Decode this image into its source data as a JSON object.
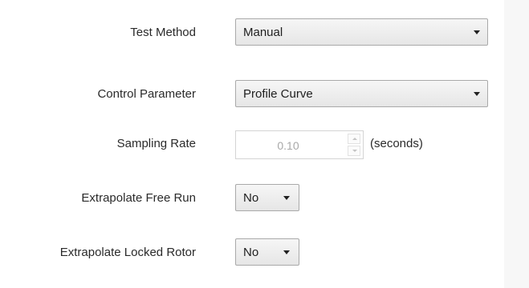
{
  "form": {
    "test_method": {
      "label": "Test Method",
      "value": "Manual"
    },
    "control_parameter": {
      "label": "Control Parameter",
      "value": "Profile Curve"
    },
    "sampling_rate": {
      "label": "Sampling Rate",
      "value": "0.10",
      "unit": "(seconds)",
      "enabled": false
    },
    "extrapolate_free_run": {
      "label": "Extrapolate Free Run",
      "value": "No"
    },
    "extrapolate_locked_rotor": {
      "label": "Extrapolate Locked Rotor",
      "value": "No"
    }
  },
  "icons": {
    "dropdown": "chevron-down-icon",
    "spinner_up": "spin-up-icon",
    "spinner_down": "spin-down-icon"
  },
  "colors": {
    "background": "#ffffff",
    "combo_border": "#a9a9a9",
    "disabled_text": "#a8a8a8"
  }
}
